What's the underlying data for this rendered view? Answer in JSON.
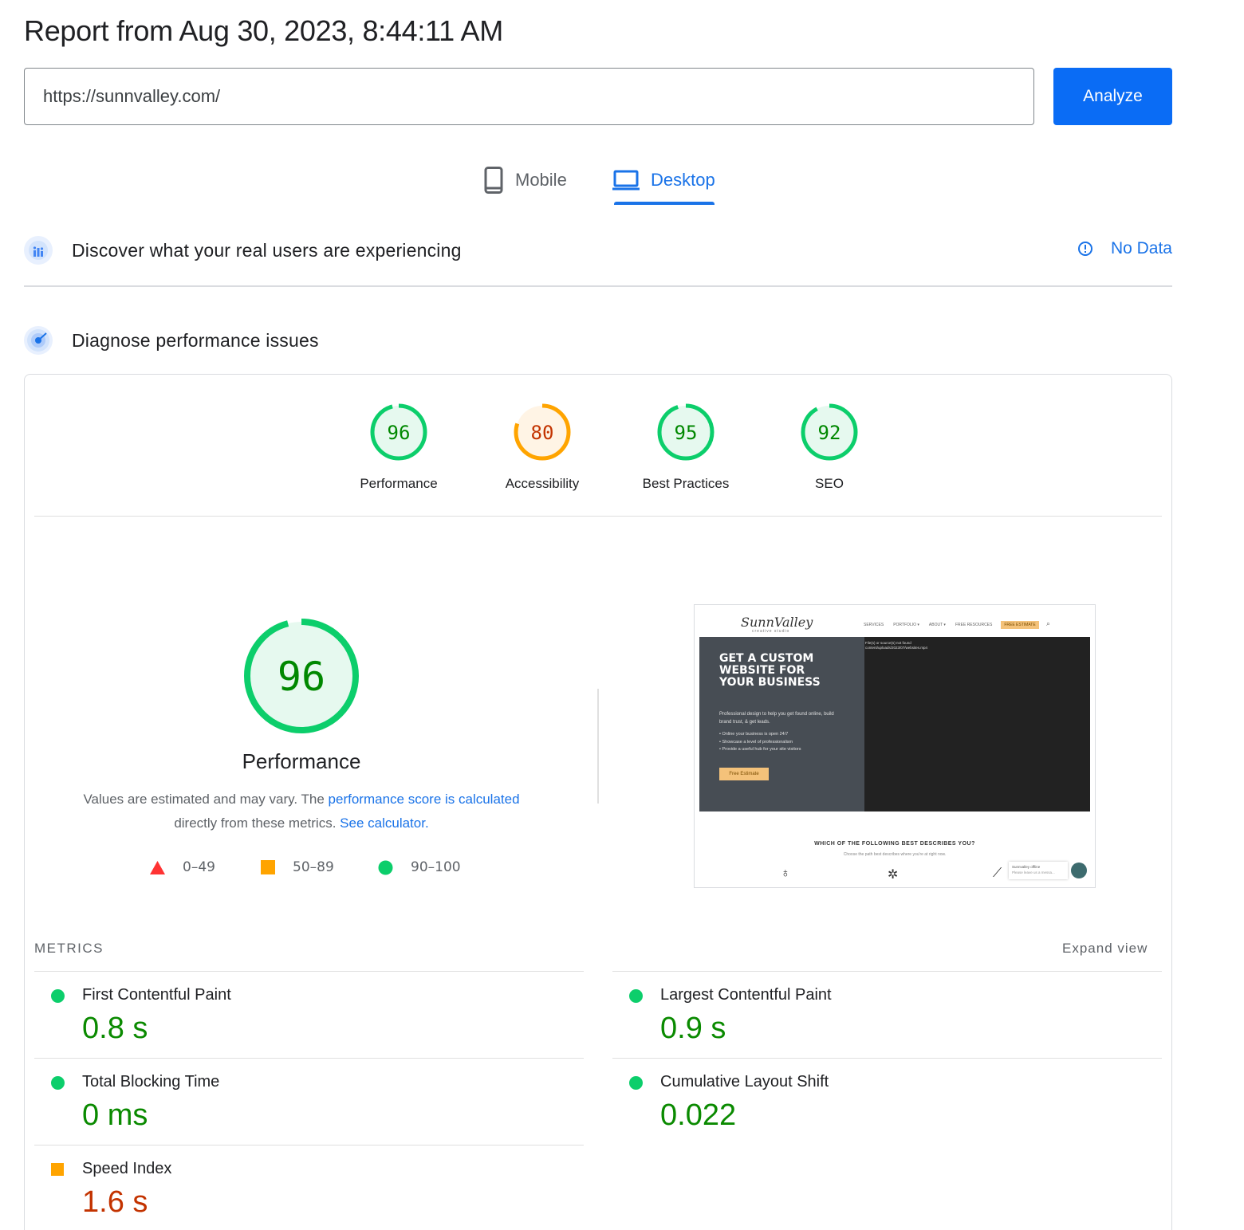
{
  "report": {
    "title": "Report from Aug 30, 2023, 8:44:11 AM"
  },
  "url_input": {
    "value": "https://sunnvalley.com/"
  },
  "analyze_label": "Analyze",
  "tabs": [
    {
      "label": "Mobile",
      "icon": "phone-icon",
      "selected": false
    },
    {
      "label": "Desktop",
      "icon": "laptop-icon",
      "selected": true
    }
  ],
  "crux": {
    "title": "Discover what your real users are experiencing",
    "status": "No Data",
    "icon": "field-data-icon"
  },
  "diagnose": {
    "title": "Diagnose performance issues",
    "icon": "lab-data-icon"
  },
  "categories": [
    {
      "label": "Performance",
      "score": "96",
      "rating": "pass"
    },
    {
      "label": "Accessibility",
      "score": "80",
      "rating": "average"
    },
    {
      "label": "Best Practices",
      "score": "95",
      "rating": "pass"
    },
    {
      "label": "SEO",
      "score": "92",
      "rating": "pass"
    }
  ],
  "performance": {
    "score": "96",
    "title": "Performance",
    "desc_prefix": "Values are estimated and may vary. The ",
    "desc_link1": "performance score is calculated",
    "desc_middle": " directly from these metrics. ",
    "desc_link2": "See calculator."
  },
  "legend": [
    {
      "range": "0–49",
      "shape": "triangle",
      "color": "#ff3333"
    },
    {
      "range": "50–89",
      "shape": "square",
      "color": "#ffa400"
    },
    {
      "range": "90–100",
      "shape": "circle",
      "color": "#0cce6b"
    }
  ],
  "screenshot": {
    "logo": "SunnValley",
    "logo_sub": "creative studio",
    "nav": [
      "SERVICES",
      "PORTFOLIO ▾",
      "ABOUT ▾",
      "FREE RESOURCES"
    ],
    "nav_cta": "FREE ESTIMATE",
    "hero_heading": "GET A CUSTOM WEBSITE FOR YOUR BUSINESS",
    "hero_text": "Professional design to help you get found online, build brand trust, & get leads.",
    "hero_bullets": [
      "Online your business is open 24/7",
      "Showcase a level of professionalism",
      "Provide a useful hub for your site visitors"
    ],
    "hero_button": "Free Estimate",
    "error_line1": "File(s) or source(s) not found",
    "error_line2": "content/uploads/2023/07/websites.mp4",
    "question": "WHICH OF THE FOLLOWING BEST DESCRIBES YOU?",
    "question_sub": "Choose the path best describes where you're at right now.",
    "chat_title": "Sunnvalley offline",
    "chat_text": "Please leave us a messa..."
  },
  "metrics": {
    "label": "METRICS",
    "expand": "Expand view",
    "items": [
      {
        "name": "First Contentful Paint",
        "value": "0.8 s",
        "rating": "pass"
      },
      {
        "name": "Largest Contentful Paint",
        "value": "0.9 s",
        "rating": "pass"
      },
      {
        "name": "Total Blocking Time",
        "value": "0 ms",
        "rating": "pass"
      },
      {
        "name": "Cumulative Layout Shift",
        "value": "0.022",
        "rating": "pass"
      },
      {
        "name": "Speed Index",
        "value": "1.6 s",
        "rating": "average"
      }
    ]
  },
  "colors": {
    "pass": "#0cce6b",
    "pass_text": "#008800",
    "average": "#ffa400",
    "average_text": "#c33300",
    "accent": "#1a73e8"
  }
}
